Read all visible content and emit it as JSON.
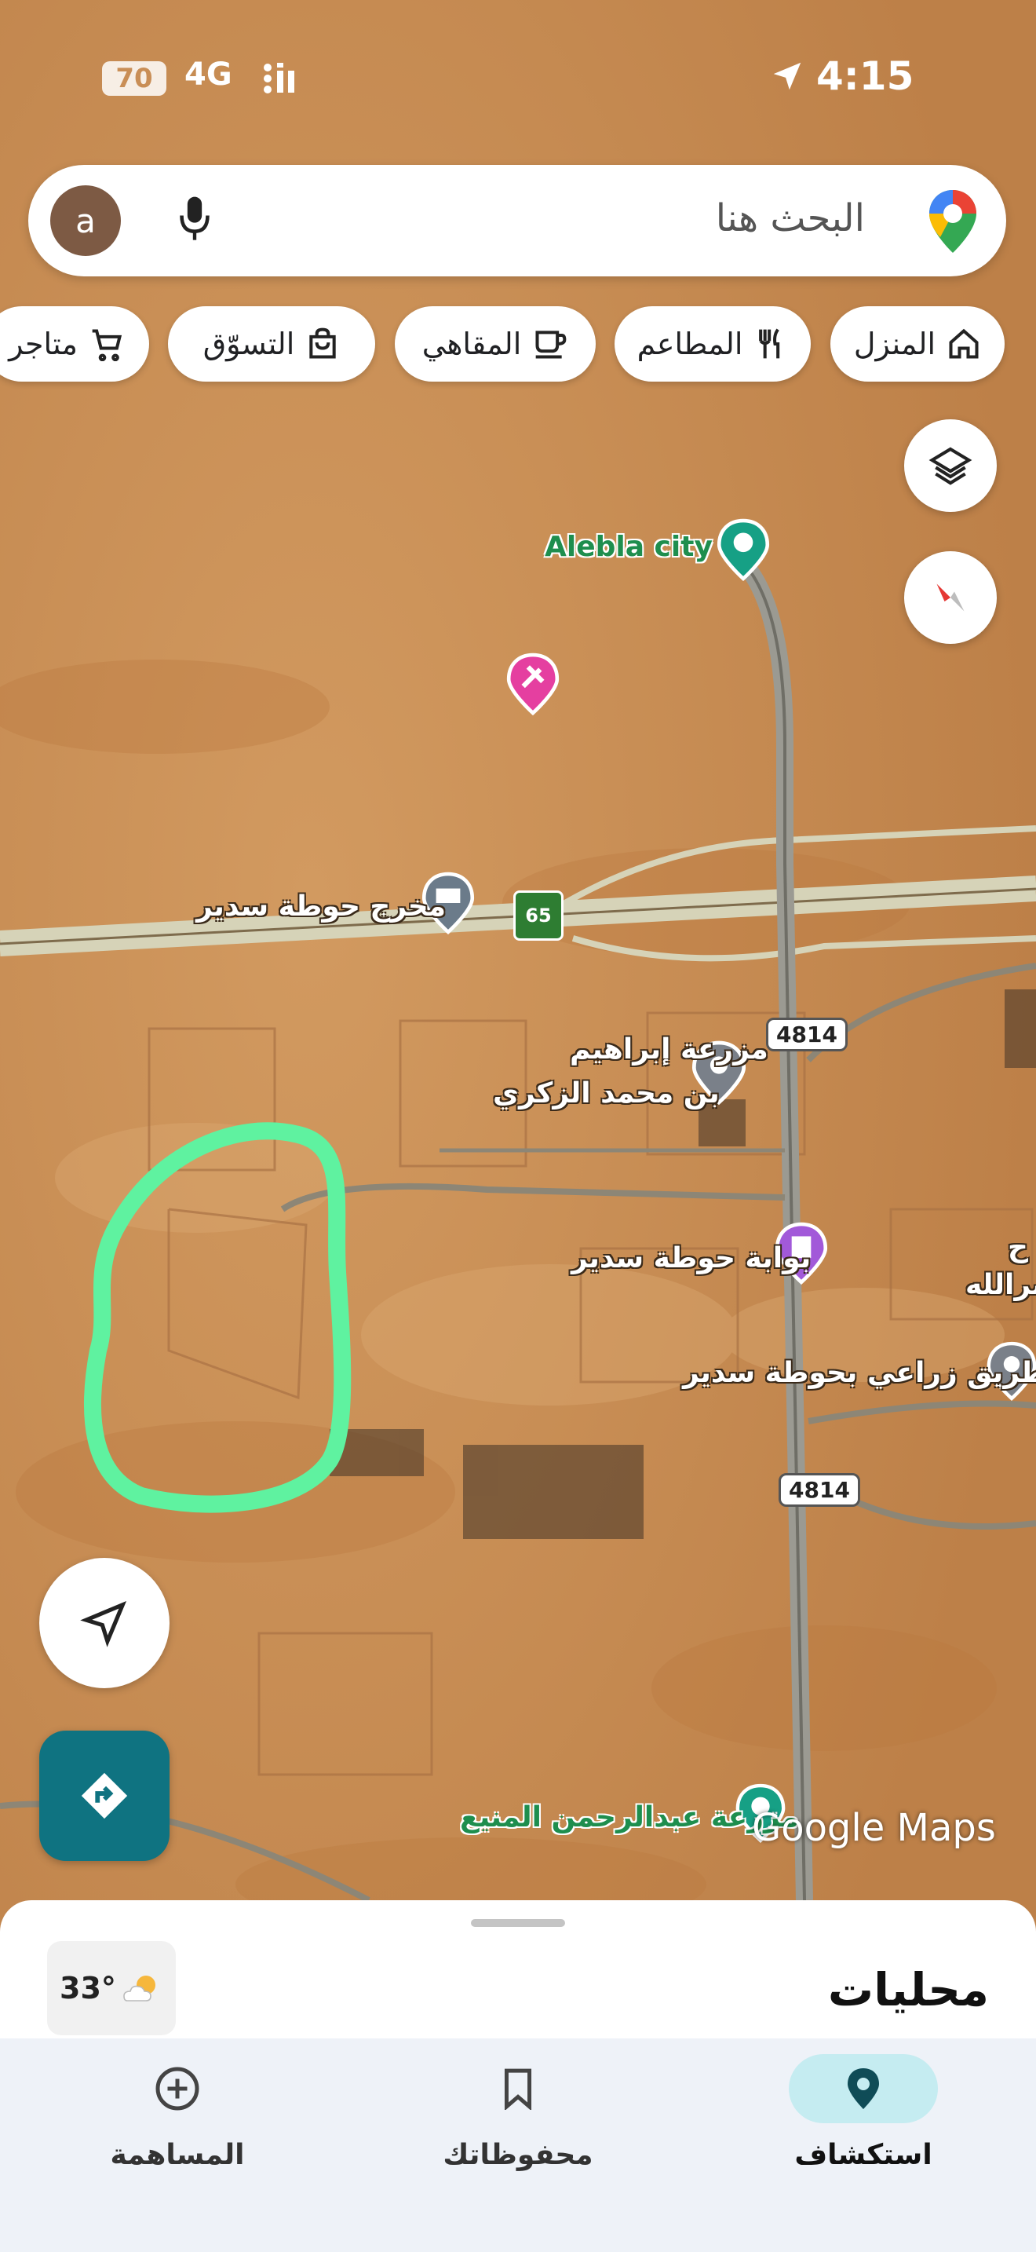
{
  "status_bar": {
    "battery": "70",
    "network": "4G",
    "time": "4:15"
  },
  "search": {
    "placeholder": "البحث هنا",
    "avatar_letter": "a"
  },
  "chips": [
    {
      "label": "المنزل",
      "icon": "home-icon"
    },
    {
      "label": "المطاعم",
      "icon": "restaurant-icon"
    },
    {
      "label": "المقاهي",
      "icon": "cafe-icon"
    },
    {
      "label": "التسوّق",
      "icon": "shopping-bag-icon"
    },
    {
      "label": "متاجر",
      "icon": "cart-icon"
    }
  ],
  "map": {
    "labels": {
      "alebla": "Alebla city",
      "exit": "مخرج حوطة سدير",
      "farm_ibrahim_1": "مزرعة إبراهيم",
      "farm_ibrahim_2": "بن محمد الزكري",
      "gate": "بوابة حوطة سدير",
      "farm_road": "طريق زراعي بحوطة سدير",
      "farm_abdulrahman": "مزرعة عبدالرحمن المنيع",
      "edge_1": "ح",
      "edge_2": "صرالله"
    },
    "route_shields": {
      "highway": "65",
      "road_upper": "4814",
      "road_lower": "4814"
    },
    "attribution": "Google Maps",
    "annotation_color": "#5ff2a0"
  },
  "sheet": {
    "title": "محليات",
    "weather": "33°"
  },
  "nav": [
    {
      "label": "استكشاف",
      "icon": "location-pin-icon",
      "active": true
    },
    {
      "label": "محفوظاتك",
      "icon": "bookmark-icon",
      "active": false
    },
    {
      "label": "المساهمة",
      "icon": "add-circle-icon",
      "active": false
    }
  ]
}
